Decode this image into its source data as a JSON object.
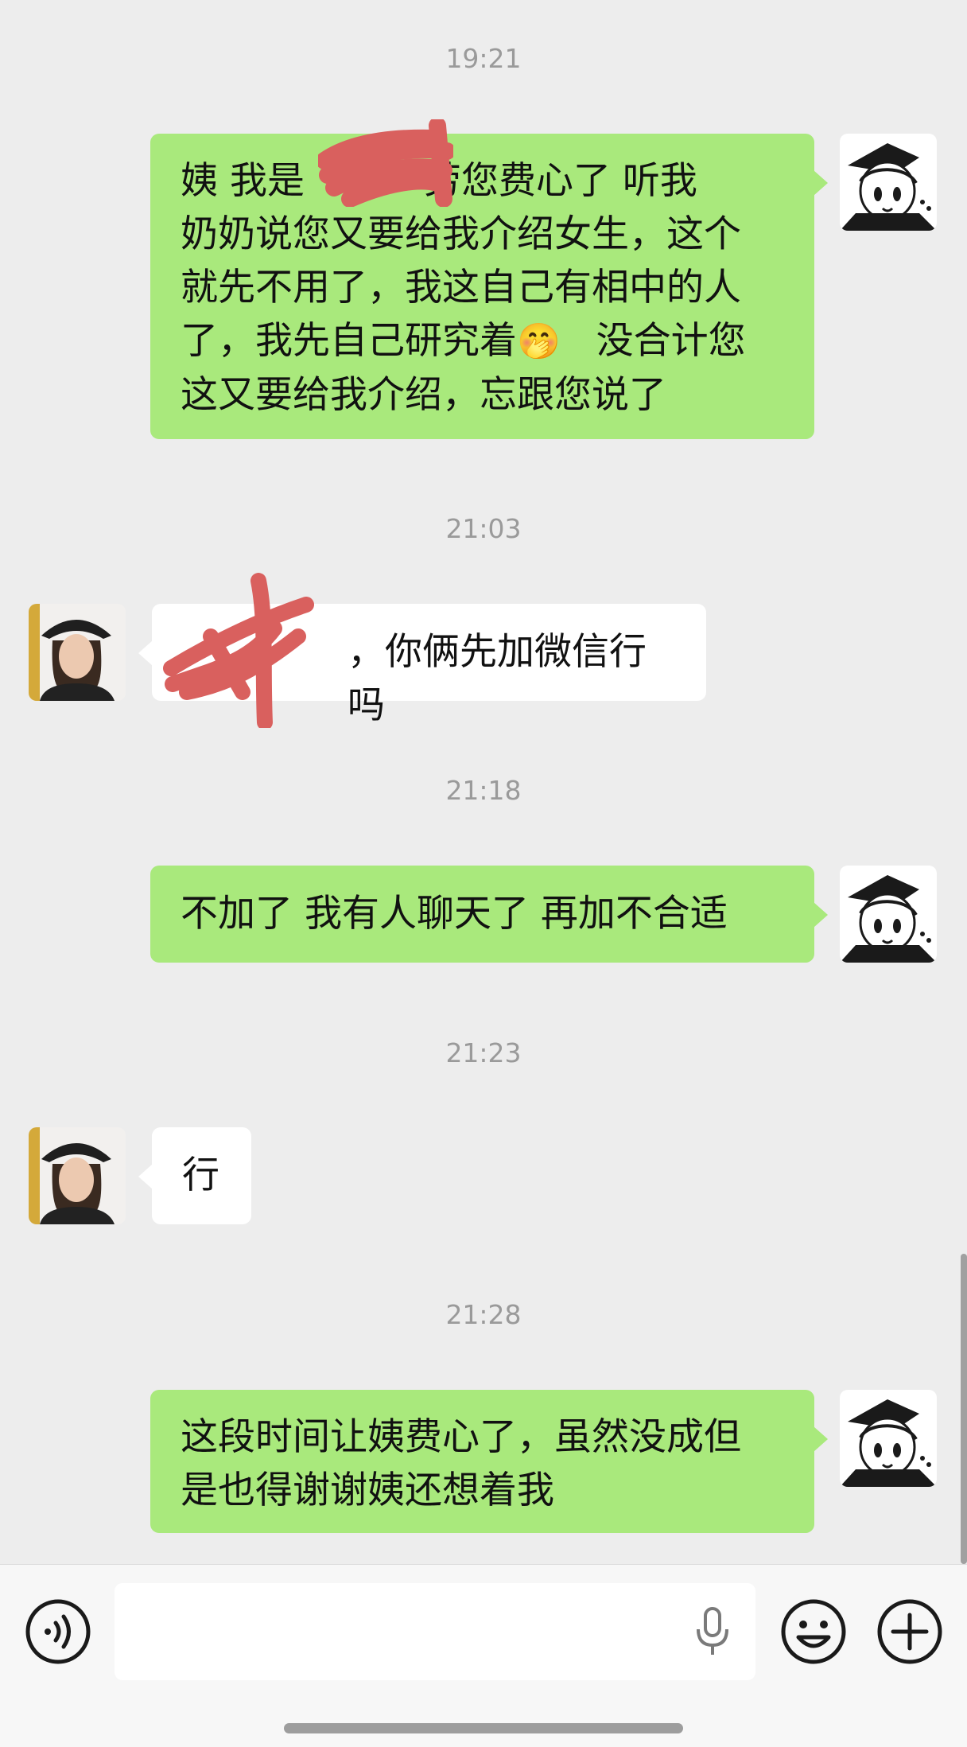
{
  "conversation": [
    {
      "type": "timestamp",
      "text": "19:21"
    },
    {
      "type": "message",
      "side": "me",
      "parts": [
        "姨  我是",
        "劳您费心了  听我",
        "奶奶说您又要给我介绍女生，这个",
        "就先不用了，我这自己有相中的人",
        "了，我先自己研究着",
        "没合计您",
        "这又要给我介绍，忘跟您说了"
      ],
      "emoji": "🤭"
    },
    {
      "type": "timestamp",
      "text": "21:03"
    },
    {
      "type": "message",
      "side": "them",
      "text": "，你俩先加微信行吗"
    },
    {
      "type": "timestamp",
      "text": "21:18"
    },
    {
      "type": "message",
      "side": "me",
      "text": "不加了  我有人聊天了  再加不合适"
    },
    {
      "type": "timestamp",
      "text": "21:23"
    },
    {
      "type": "message",
      "side": "them",
      "text": "行"
    },
    {
      "type": "timestamp",
      "text": "21:28"
    },
    {
      "type": "message",
      "side": "me",
      "lines": [
        "这段时间让姨费心了，虽然没成但",
        "是也得谢谢姨还想着我"
      ]
    }
  ],
  "icons": {
    "voice": "voice-icon",
    "mic": "microphone-icon",
    "emoji": "emoji-icon",
    "plus": "plus-icon"
  },
  "colors": {
    "background": "#ededed",
    "my_bubble": "#a9e97c",
    "their_bubble": "#ffffff",
    "redaction": "#d9605e",
    "timestamp": "#9a9a9a"
  }
}
